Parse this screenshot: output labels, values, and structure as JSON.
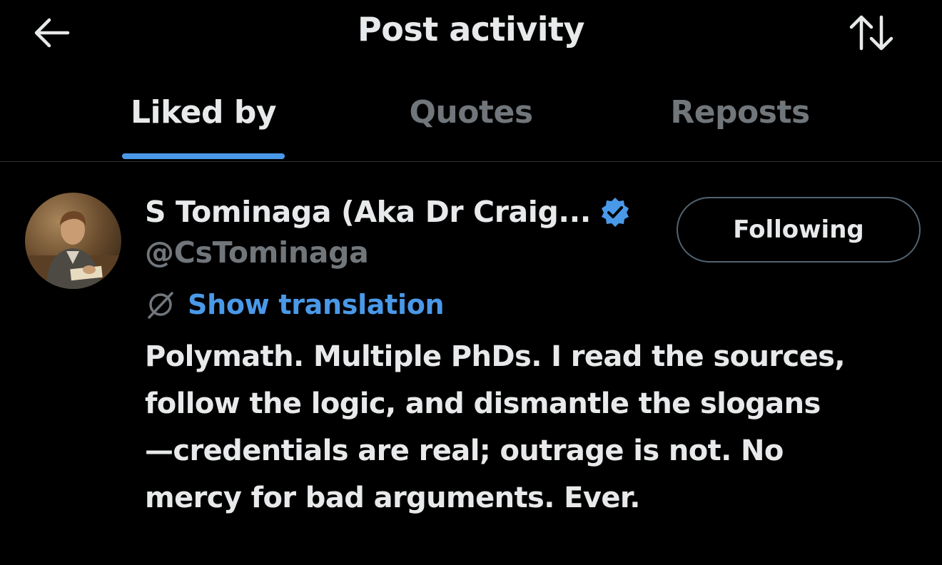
{
  "header": {
    "title": "Post activity",
    "back_icon": "arrow-left-icon",
    "sort_icon": "sort-arrows-icon"
  },
  "tabs": [
    {
      "label": "Liked by",
      "active": true
    },
    {
      "label": "Quotes",
      "active": false
    },
    {
      "label": "Reposts",
      "active": false
    }
  ],
  "user": {
    "display_name": "S Tominaga (Aka Dr Craig...",
    "handle": "@CsTominaga",
    "verified": true,
    "follow_label": "Following",
    "translate_label": "Show translation",
    "bio_lines": [
      "Polymath. Multiple PhDs. I read the sources,",
      "follow the logic, and dismantle the slogans",
      "—credentials are real; outrage is not. No",
      "mercy for bad arguments. Ever."
    ]
  },
  "colors": {
    "background": "#000000",
    "text_primary": "#e7e9ea",
    "text_secondary": "#71767b",
    "accent": "#4a99e9",
    "divider": "#2f3336"
  }
}
